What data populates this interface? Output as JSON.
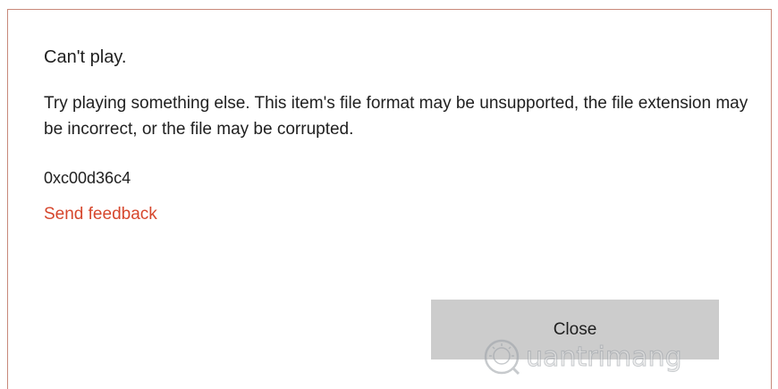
{
  "dialog": {
    "title": "Can't play.",
    "message": "Try playing something else. This item's file format may be unsupported, the file extension may be incorrect, or the file may be corrupted.",
    "error_code": "0xc00d36c4",
    "feedback_label": "Send feedback",
    "close_label": "Close"
  },
  "watermark": {
    "text": "uantrimang",
    "logo_icon": "lightbulb-q-icon"
  },
  "colors": {
    "link": "#d6472d",
    "border": "#c8897a",
    "button_bg": "#cccccc",
    "text": "#1f1f1f"
  }
}
